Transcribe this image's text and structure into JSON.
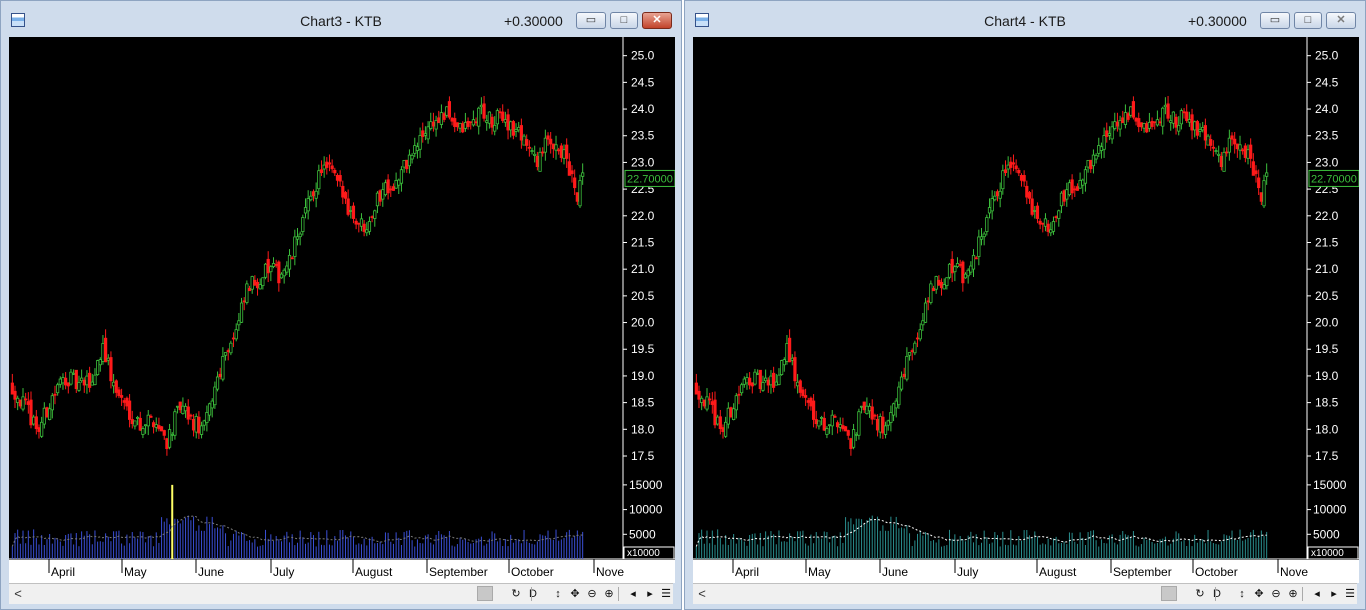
{
  "windows": [
    {
      "title": "Chart3 - KTB",
      "change": "+0.30000",
      "price_label": "22.70000",
      "active": true,
      "volume_unit": "x10000",
      "price_axis": [
        "25.0",
        "24.5",
        "24.0",
        "23.5",
        "23.0",
        "22.5",
        "22.0",
        "21.5",
        "21.0",
        "20.5",
        "20.0",
        "19.5",
        "19.0",
        "18.5",
        "18.0",
        "17.5"
      ],
      "volume_axis": [
        "15000",
        "10000",
        "5000"
      ],
      "months": [
        "April",
        "May",
        "June",
        "July",
        "August",
        "September",
        "October",
        "Nove"
      ],
      "colors": {
        "up": "#3cbf3c",
        "down": "#ff1a1a",
        "volume": "#3a4fd6",
        "ma": "#7a7a7a",
        "highlight": "#ffff66"
      }
    },
    {
      "title": "Chart4 - KTB",
      "change": "+0.30000",
      "price_label": "22.70000",
      "active": false,
      "volume_unit": "x10000",
      "price_axis": [
        "25.0",
        "24.5",
        "24.0",
        "23.5",
        "23.0",
        "22.5",
        "22.0",
        "21.5",
        "21.0",
        "20.5",
        "20.0",
        "19.5",
        "19.0",
        "18.5",
        "18.0",
        "17.5"
      ],
      "volume_axis": [
        "15000",
        "10000",
        "5000"
      ],
      "months": [
        "April",
        "May",
        "June",
        "July",
        "August",
        "September",
        "October",
        "Nove"
      ],
      "colors": {
        "up": "#3cbf3c",
        "down": "#ff1a1a",
        "volume": "#2a8f8f",
        "ma": "#ffffff"
      }
    }
  ],
  "toolbar": {
    "scroll_left": "<",
    "tools": [
      "↻",
      "D",
      "↕",
      "✥",
      "⊖",
      "⊕",
      "◂",
      "▸",
      "☰"
    ],
    "tool_icons": [
      "refresh-icon",
      "period-icon",
      "vertical-scale-icon",
      "pan-icon",
      "zoom-out-icon",
      "zoom-in-icon",
      "scroll-back-icon",
      "scroll-forward-icon",
      "menu-icon"
    ]
  },
  "chart_data": [
    {
      "type": "candlestick",
      "title": "Chart3 - KTB",
      "last_price": 22.7,
      "price_ylim": [
        17.2,
        25.2
      ],
      "volume_ylim": [
        0,
        17000
      ],
      "volume_unit": "x10000",
      "x_ticks": [
        "April",
        "May",
        "June",
        "July",
        "August",
        "September",
        "October",
        "Nove"
      ],
      "close_path": [
        [
          0,
          18.8
        ],
        [
          5,
          18.4
        ],
        [
          10,
          18.0
        ],
        [
          15,
          18.6
        ],
        [
          20,
          19.0
        ],
        [
          25,
          18.8
        ],
        [
          30,
          18.9
        ],
        [
          34,
          19.6
        ],
        [
          38,
          18.8
        ],
        [
          43,
          18.4
        ],
        [
          48,
          18.1
        ],
        [
          53,
          18.2
        ],
        [
          58,
          17.8
        ],
        [
          63,
          18.4
        ],
        [
          68,
          18.1
        ],
        [
          72,
          18.0
        ],
        [
          76,
          18.8
        ],
        [
          80,
          19.5
        ],
        [
          84,
          19.8
        ],
        [
          88,
          20.6
        ],
        [
          92,
          20.8
        ],
        [
          96,
          21.0
        ],
        [
          100,
          20.9
        ],
        [
          104,
          21.1
        ],
        [
          108,
          21.8
        ],
        [
          112,
          22.3
        ],
        [
          116,
          22.9
        ],
        [
          120,
          22.8
        ],
        [
          124,
          22.4
        ],
        [
          128,
          22.0
        ],
        [
          132,
          21.8
        ],
        [
          136,
          22.2
        ],
        [
          140,
          22.6
        ],
        [
          144,
          22.6
        ],
        [
          148,
          23.0
        ],
        [
          152,
          23.3
        ],
        [
          156,
          23.7
        ],
        [
          160,
          23.8
        ],
        [
          164,
          23.9
        ],
        [
          168,
          23.6
        ],
        [
          172,
          23.7
        ],
        [
          176,
          24.0
        ],
        [
          180,
          23.7
        ],
        [
          184,
          23.9
        ],
        [
          188,
          23.6
        ],
        [
          192,
          23.5
        ],
        [
          196,
          23.0
        ],
        [
          200,
          23.3
        ],
        [
          204,
          23.4
        ],
        [
          208,
          23.0
        ],
        [
          212,
          22.3
        ],
        [
          214,
          22.7
        ]
      ],
      "volume_spike": {
        "index": 60,
        "value": 15000
      }
    },
    {
      "type": "candlestick",
      "title": "Chart4 - KTB",
      "last_price": 22.7,
      "price_ylim": [
        17.2,
        25.2
      ],
      "volume_ylim": [
        0,
        17000
      ],
      "volume_unit": "x10000",
      "x_ticks": [
        "April",
        "May",
        "June",
        "July",
        "August",
        "September",
        "October",
        "Nove"
      ],
      "close_path": [
        [
          0,
          18.8
        ],
        [
          5,
          18.4
        ],
        [
          10,
          18.0
        ],
        [
          15,
          18.6
        ],
        [
          20,
          19.0
        ],
        [
          25,
          18.8
        ],
        [
          30,
          18.9
        ],
        [
          34,
          19.6
        ],
        [
          38,
          18.8
        ],
        [
          43,
          18.4
        ],
        [
          48,
          18.1
        ],
        [
          53,
          18.2
        ],
        [
          58,
          17.8
        ],
        [
          63,
          18.4
        ],
        [
          68,
          18.1
        ],
        [
          72,
          18.0
        ],
        [
          76,
          18.8
        ],
        [
          80,
          19.5
        ],
        [
          84,
          19.8
        ],
        [
          88,
          20.6
        ],
        [
          92,
          20.8
        ],
        [
          96,
          21.0
        ],
        [
          100,
          20.9
        ],
        [
          104,
          21.1
        ],
        [
          108,
          21.8
        ],
        [
          112,
          22.3
        ],
        [
          116,
          22.9
        ],
        [
          120,
          22.8
        ],
        [
          124,
          22.4
        ],
        [
          128,
          22.0
        ],
        [
          132,
          21.8
        ],
        [
          136,
          22.2
        ],
        [
          140,
          22.6
        ],
        [
          144,
          22.6
        ],
        [
          148,
          23.0
        ],
        [
          152,
          23.3
        ],
        [
          156,
          23.7
        ],
        [
          160,
          23.8
        ],
        [
          164,
          23.9
        ],
        [
          168,
          23.6
        ],
        [
          172,
          23.7
        ],
        [
          176,
          24.0
        ],
        [
          180,
          23.7
        ],
        [
          184,
          23.9
        ],
        [
          188,
          23.6
        ],
        [
          192,
          23.5
        ],
        [
          196,
          23.0
        ],
        [
          200,
          23.3
        ],
        [
          204,
          23.4
        ],
        [
          208,
          23.0
        ],
        [
          212,
          22.3
        ],
        [
          214,
          22.7
        ]
      ]
    }
  ]
}
